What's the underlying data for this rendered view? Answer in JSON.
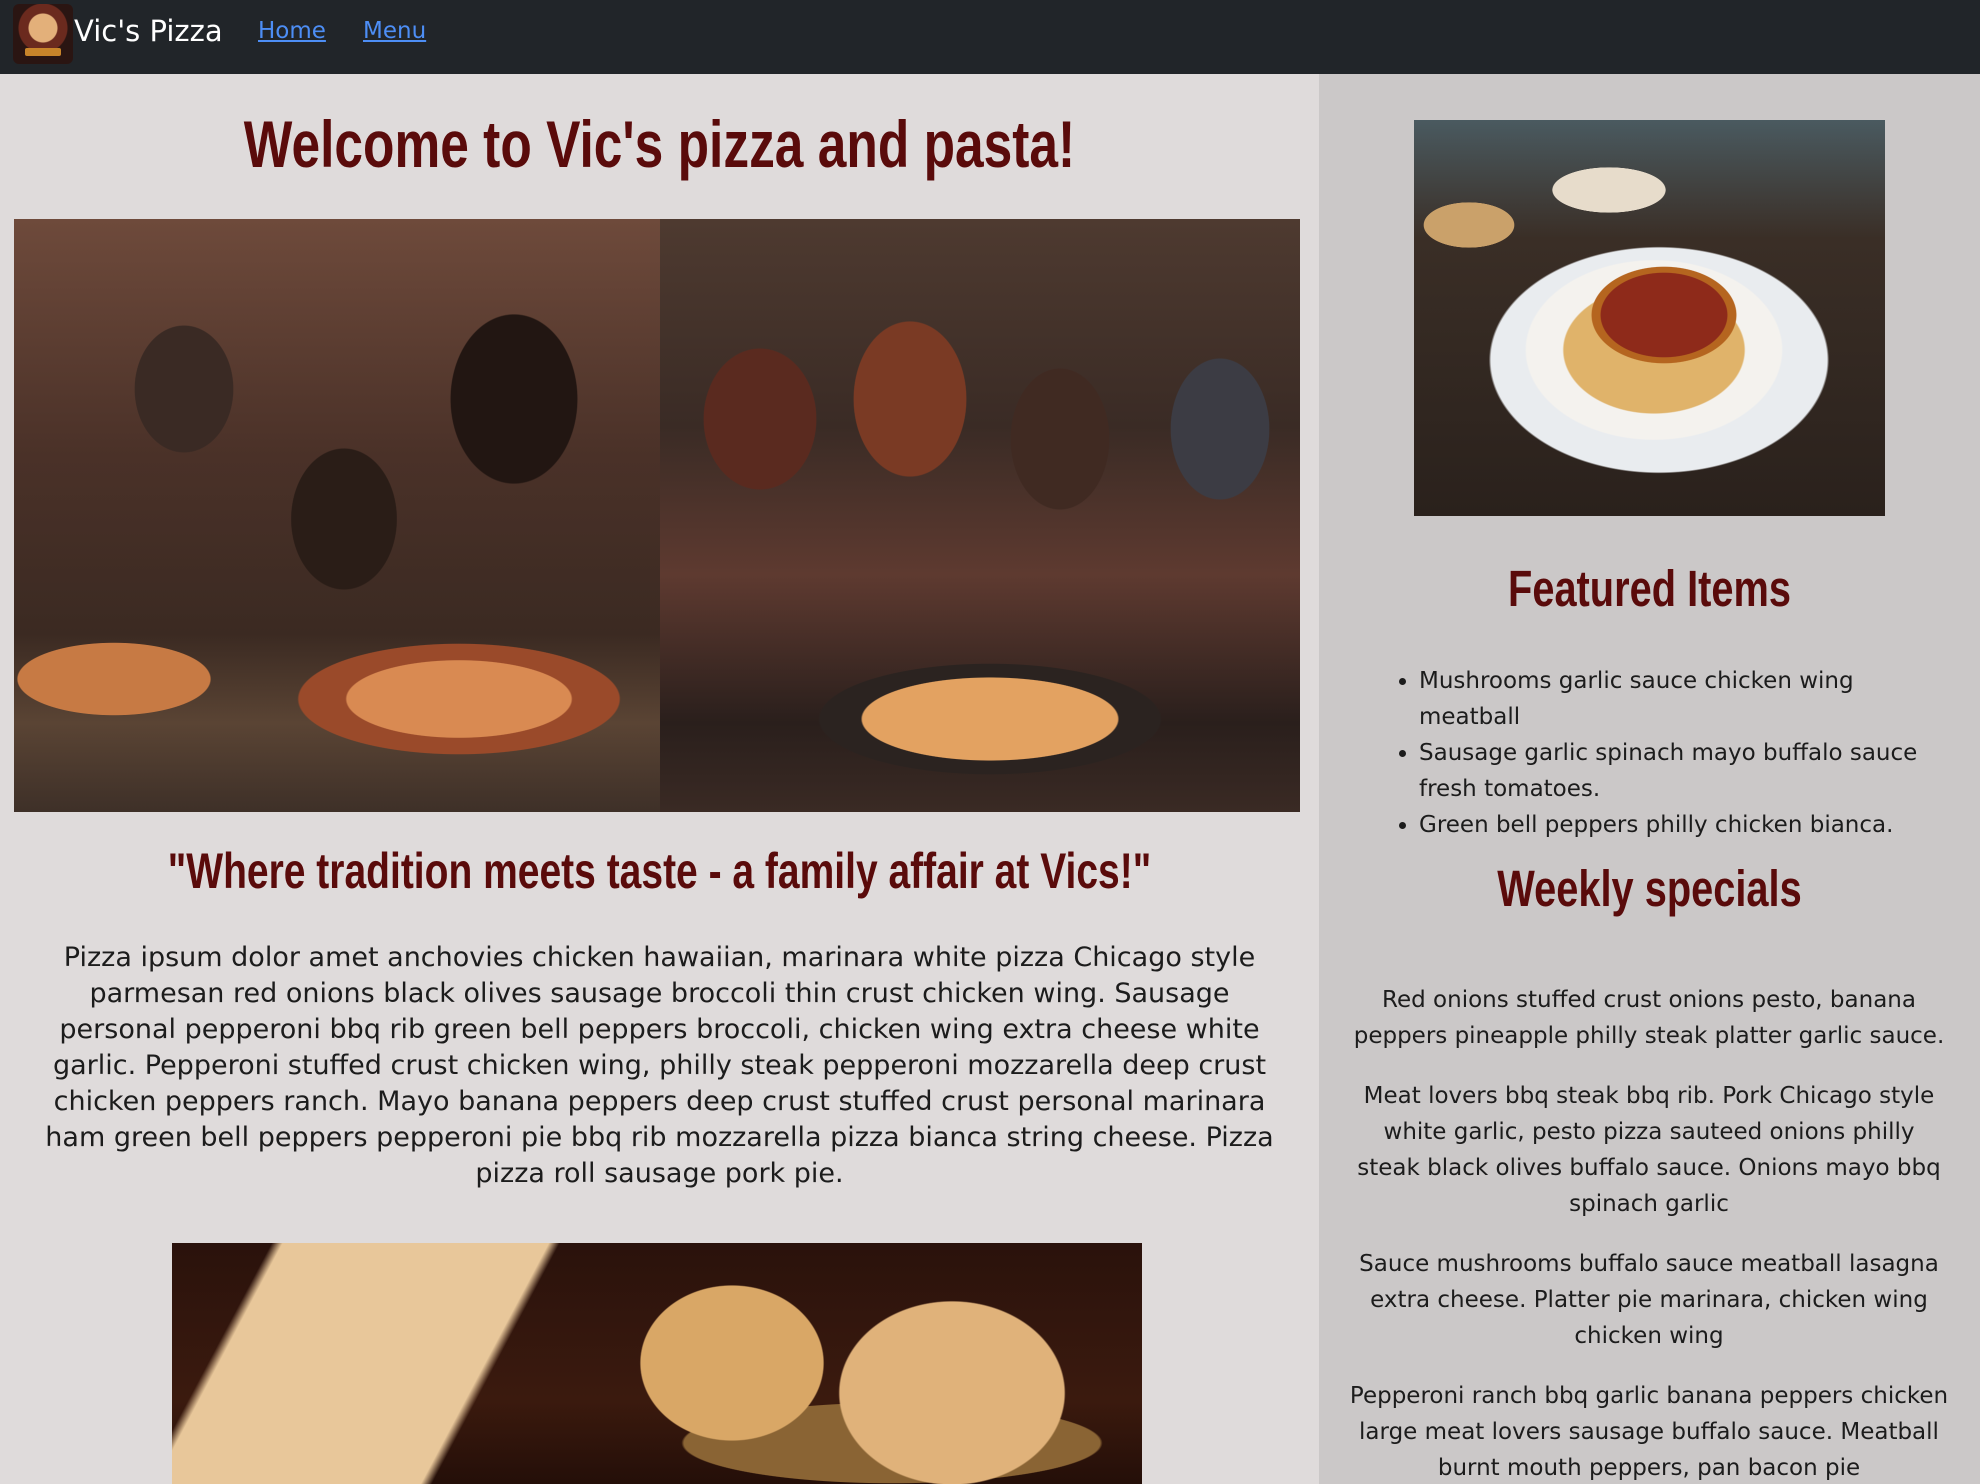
{
  "navbar": {
    "brand": "Vic's Pizza",
    "links": [
      "Home",
      "Menu"
    ]
  },
  "main": {
    "welcome_title": "Welcome to Vic's pizza and pasta!",
    "tagline": "\"Where tradition meets taste - a family affair at Vics!\"",
    "intro": "Pizza ipsum dolor amet anchovies chicken hawaiian, marinara white pizza Chicago style parmesan red onions black olives sausage broccoli thin crust chicken wing. Sausage personal pepperoni bbq rib green bell peppers broccoli, chicken wing extra cheese white garlic. Pepperoni stuffed crust chicken wing, philly steak pepperoni mozzarella deep crust chicken peppers ranch. Mayo banana peppers deep crust stuffed crust personal marinara ham green bell peppers pepperoni pie bbq rib mozzarella pizza bianca string cheese. Pizza pizza roll sausage pork pie."
  },
  "sidebar": {
    "featured_title": "Featured Items",
    "featured_items": [
      "Mushrooms garlic sauce chicken wing meatball",
      "Sausage garlic spinach mayo buffalo sauce fresh tomatoes.",
      "Green bell peppers philly chicken bianca."
    ],
    "weekly_title": "Weekly specials",
    "specials": [
      "Red onions stuffed crust onions pesto, banana peppers pineapple philly steak platter garlic sauce.",
      "Meat lovers bbq steak bbq rib. Pork Chicago style white garlic, pesto pizza sauteed onions philly steak black olives buffalo sauce. Onions mayo bbq spinach garlic",
      "Sauce mushrooms buffalo sauce meatball lasagna extra cheese. Platter pie marinara, chicken wing chicken wing",
      "Pepperoni ranch bbq garlic banana peppers chicken large meat lovers sausage buffalo sauce. Meatball burnt mouth peppers, pan bacon pie"
    ]
  }
}
